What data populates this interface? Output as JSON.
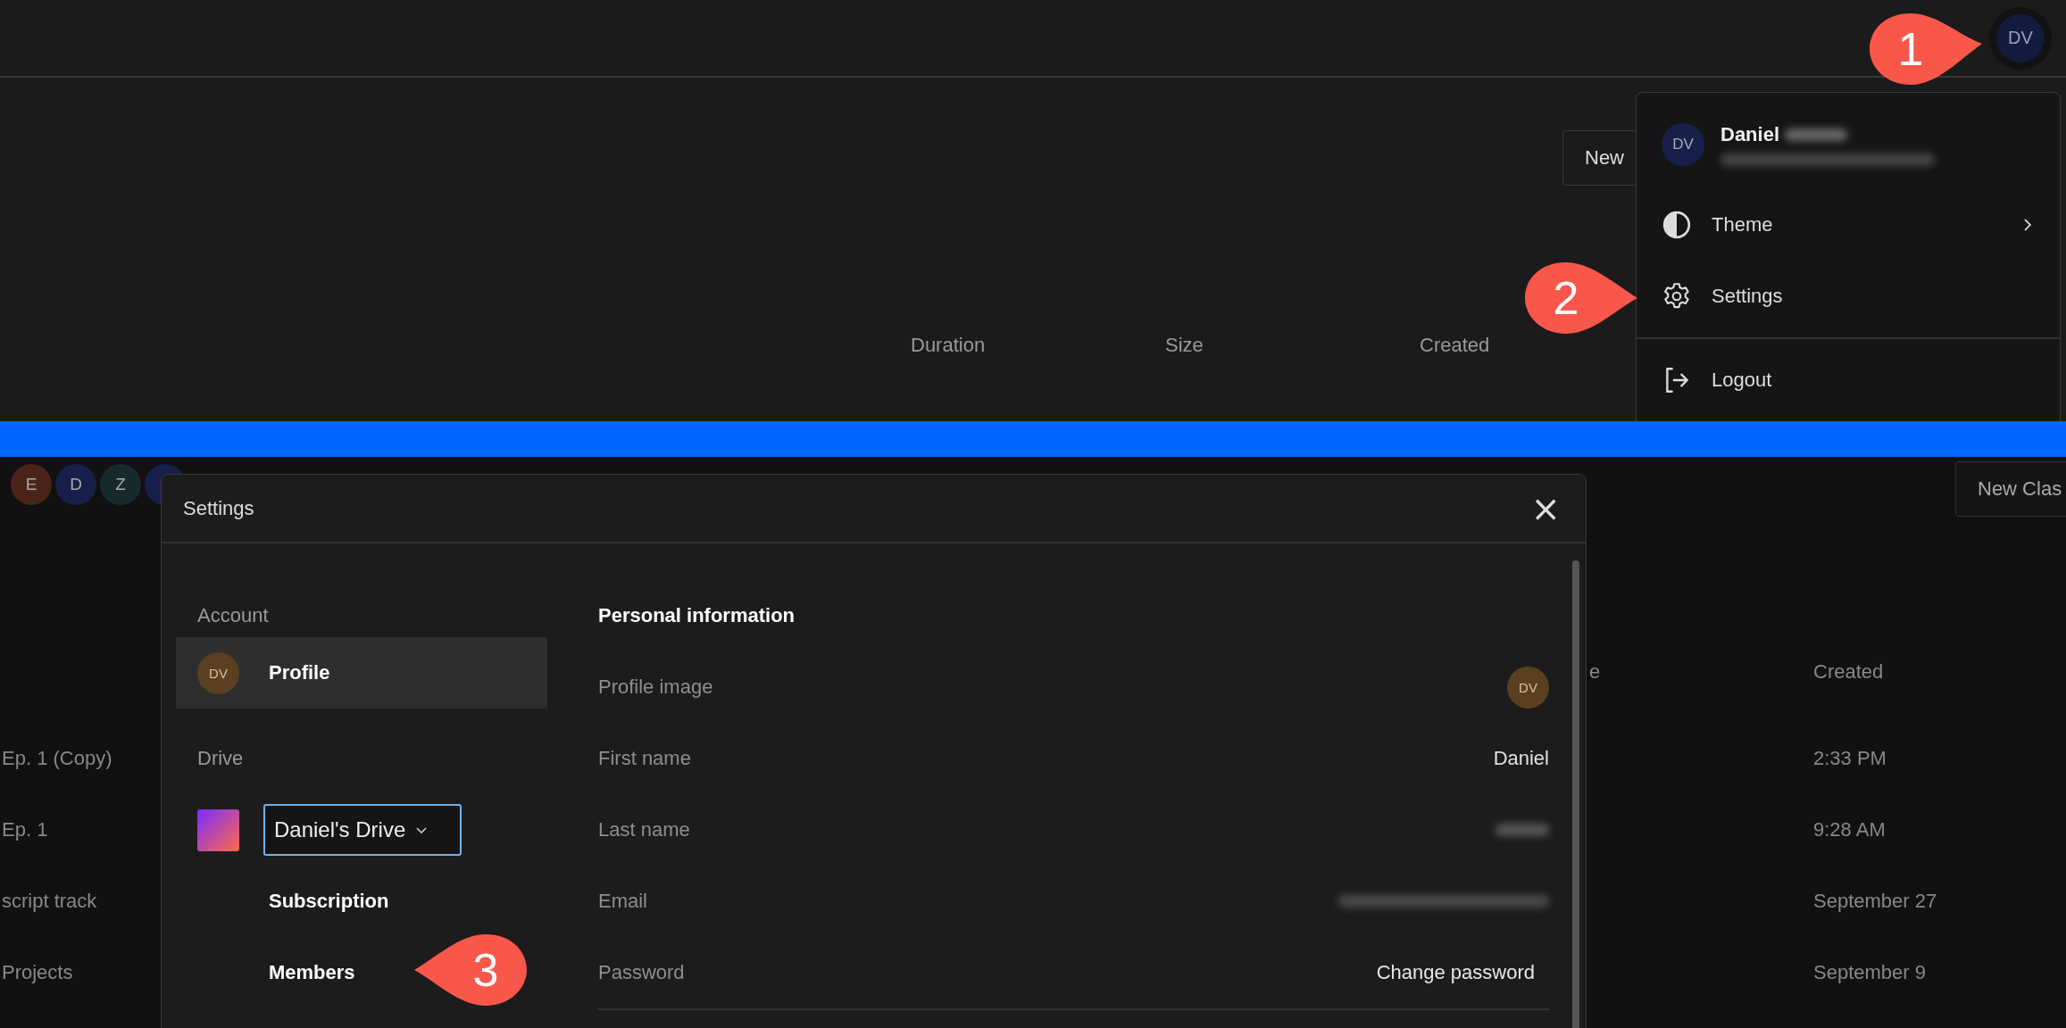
{
  "top_panel": {
    "avatar": "DV",
    "avatar_callout": "1",
    "new_button": "New",
    "columns": [
      "Duration",
      "Size",
      "Created"
    ],
    "user_menu": {
      "avatar": "DV",
      "name": "Daniel",
      "items": [
        {
          "kind": "submenu",
          "label": "Theme"
        },
        {
          "kind": "action",
          "label": "Settings"
        },
        {
          "kind": "divider"
        },
        {
          "kind": "action",
          "label": "Logout"
        }
      ]
    },
    "settings_callout": "2"
  },
  "bottom_panel": {
    "member_avatars": [
      {
        "letter": "E",
        "color": "#4a2418"
      },
      {
        "letter": "D",
        "color": "#16204a"
      },
      {
        "letter": "Z",
        "color": "#172a2e"
      },
      {
        "color": "#16204a"
      }
    ],
    "new_button": "New Clas",
    "table": {
      "column_tail": "e",
      "created_header": "Created",
      "rows": [
        {
          "name": "Ep. 1 (Copy)",
          "created": "2:33 PM"
        },
        {
          "name": "Ep. 1",
          "created": "9:28 AM"
        },
        {
          "name": "script track",
          "created": "September 27"
        },
        {
          "name": "Projects",
          "created": "September 9"
        }
      ]
    },
    "settings_dialog": {
      "title": "Settings",
      "close": "×",
      "nav": [
        {
          "heading": "Account",
          "items": [
            {
              "kind": "profile",
              "avatar": "DV",
              "label": "Profile",
              "selected": true
            }
          ]
        },
        {
          "heading": "Drive",
          "items": [
            {
              "kind": "drive",
              "label": "Daniel's Drive",
              "selected": false
            },
            {
              "kind": "link",
              "label": "Subscription",
              "selected": false
            },
            {
              "kind": "link",
              "label": "Members",
              "selected": false
            }
          ]
        }
      ],
      "heading": "Personal information",
      "rows": [
        {
          "kind": "avatar",
          "label": "Profile image",
          "value": "DV"
        },
        {
          "kind": "text",
          "label": "First name",
          "value": "Daniel"
        },
        {
          "kind": "blurred",
          "label": "Last name"
        },
        {
          "kind": "blurred_long",
          "label": "Email"
        },
        {
          "kind": "button",
          "label": "Password",
          "value": "Change password"
        }
      ]
    },
    "members_callout": "3"
  }
}
